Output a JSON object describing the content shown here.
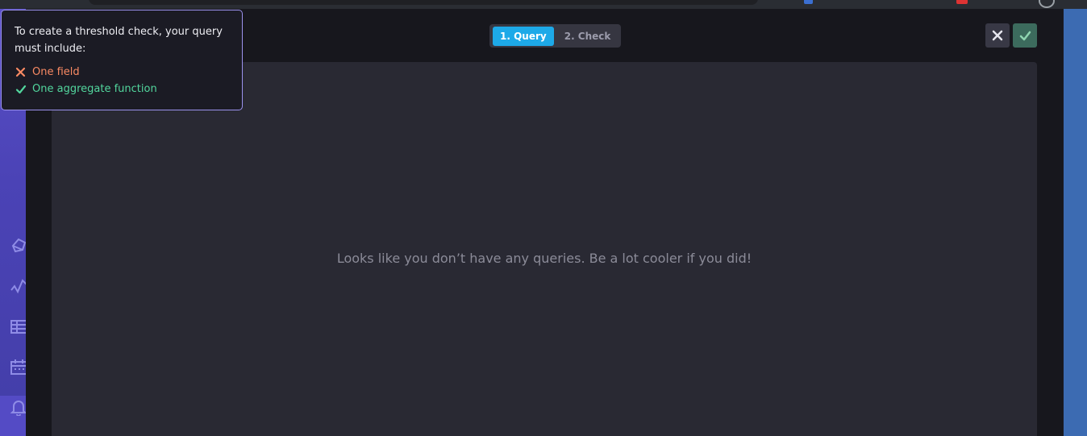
{
  "tooltip": {
    "title": "To create a threshold check, your query must include:",
    "requirements": [
      {
        "label": "One field",
        "status": "missing",
        "icon": "x-icon",
        "color": "#f98a63"
      },
      {
        "label": "One aggregate function",
        "status": "met",
        "icon": "check-icon",
        "color": "#52d69d"
      }
    ]
  },
  "stepper": {
    "steps": [
      {
        "label": "1. Query",
        "active": true
      },
      {
        "label": "2. Check",
        "active": false
      }
    ]
  },
  "actions": {
    "close_icon": "close-icon",
    "confirm_icon": "check-icon"
  },
  "query_panel": {
    "empty_message": "Looks like you don’t have any queries. Be a lot cooler if you did!"
  },
  "sidebar": {
    "icons": [
      "data-explorer-icon",
      "graph-icon",
      "table-icon",
      "calendar-icon",
      "bell-icon"
    ],
    "active_icon": "bell-icon"
  },
  "colors": {
    "accent": "#1da9e8",
    "nav": "#4b43b6",
    "tooltip_border": "#9c92ee",
    "confirm": "#3c6b5d"
  }
}
